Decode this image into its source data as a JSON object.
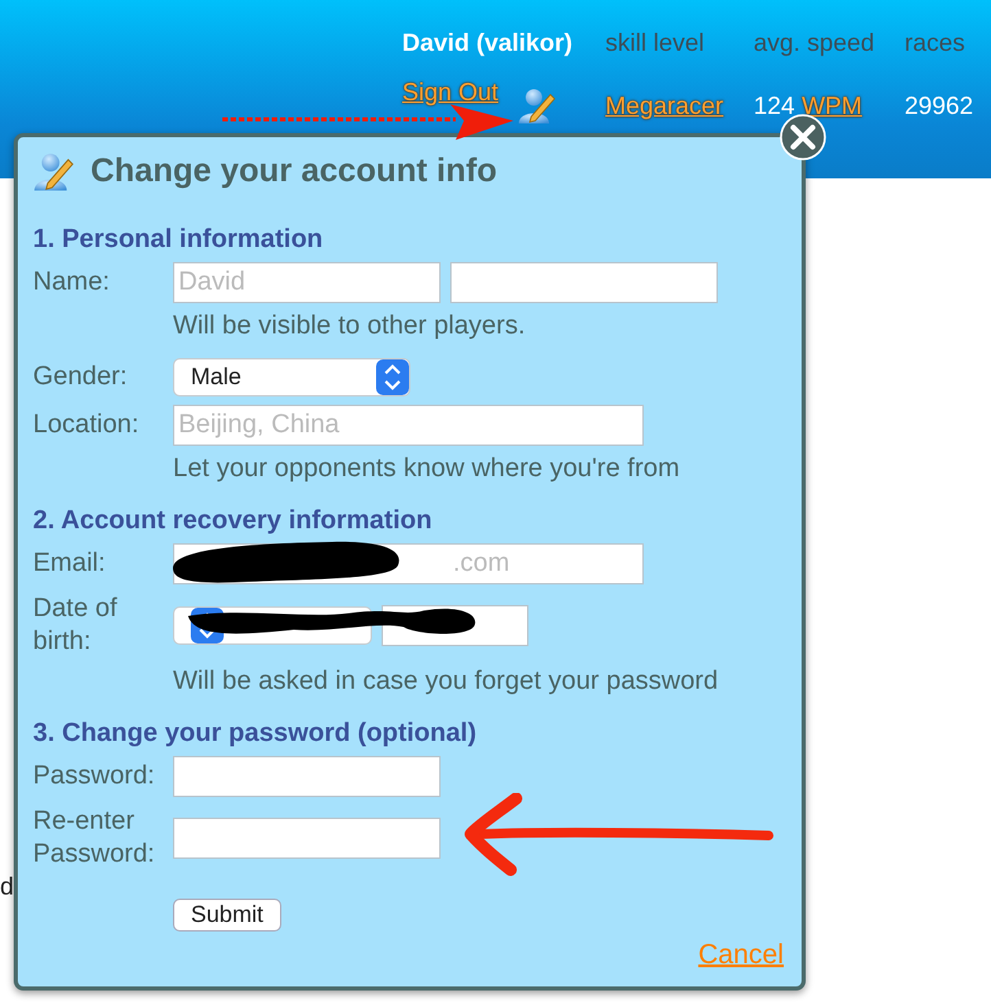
{
  "header": {
    "user": "David (valikor)",
    "columns": [
      "skill level",
      "avg. speed",
      "races"
    ],
    "sign_out": "Sign Out",
    "skill": "Megaracer",
    "speed_value": "124",
    "speed_unit": "WPM",
    "races": "29962"
  },
  "page_fragment": "d",
  "dialog": {
    "title": "Change your account info",
    "sections": [
      {
        "heading": "1. Personal information",
        "rows": [
          {
            "label": "Name:",
            "fields": [
              {
                "kind": "text",
                "placeholder": "David"
              },
              {
                "kind": "text"
              }
            ]
          },
          {
            "kind": "hint",
            "text": "Will be visible to other players."
          },
          {
            "label": "Gender:",
            "fields": [
              {
                "kind": "select",
                "value": "Male"
              }
            ]
          },
          {
            "label": "Location:",
            "fields": [
              {
                "kind": "long",
                "placeholder": "Beijing, China"
              }
            ]
          },
          {
            "kind": "hint",
            "text": "Let your opponents know where you're from"
          }
        ]
      },
      {
        "heading": "2. Account recovery information",
        "rows": [
          {
            "label": "Email:",
            "fields": [
              {
                "kind": "long",
                "value": ".com",
                "redacted": true
              }
            ]
          },
          {
            "label": "Date of birth:",
            "redacted": true,
            "fields": [
              {
                "kind": "select"
              },
              {
                "kind": "small"
              }
            ]
          },
          {
            "kind": "hint",
            "text": "Will be asked in case you forget your password"
          }
        ]
      },
      {
        "heading": "3. Change your password (optional)",
        "rows": [
          {
            "label": "Password:",
            "fields": [
              {
                "kind": "text"
              }
            ]
          },
          {
            "label": "Re-enter Password:",
            "fields": [
              {
                "kind": "text"
              }
            ]
          },
          {
            "kind": "button",
            "text": "Submit"
          }
        ]
      }
    ],
    "cancel": "Cancel"
  },
  "annotations": [
    {
      "kind": "dotted-arrow"
    },
    {
      "kind": "brush-arrow"
    }
  ]
}
